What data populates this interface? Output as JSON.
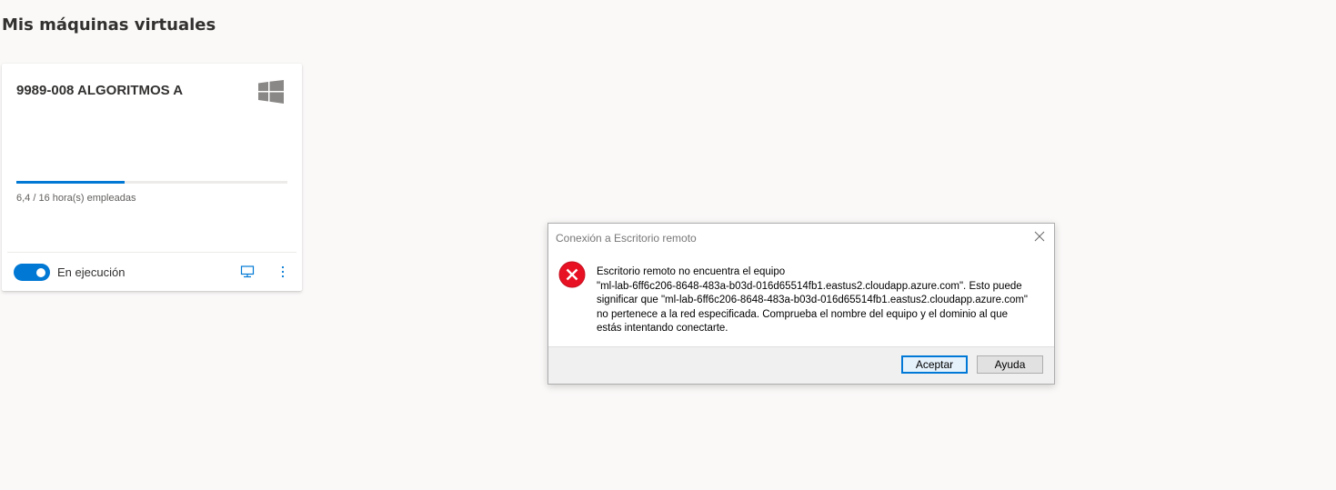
{
  "page": {
    "title": "Mis máquinas virtuales"
  },
  "vm_card": {
    "name": "9989-008 ALGORITMOS A",
    "os_icon": "windows-logo-icon",
    "usage_text": "6,4 / 16 hora(s) empleadas",
    "usage_fraction": 0.4,
    "status_label": "En ejecución",
    "running": true,
    "connect_icon": "monitor-icon",
    "more_icon": "more-vertical-icon",
    "accent_color": "#0078d4"
  },
  "dialog": {
    "title": "Conexión a Escritorio remoto",
    "message": "Escritorio remoto no encuentra el equipo\n\"ml-lab-6ff6c206-8648-483a-b03d-016d65514fb1.eastus2.cloudapp.azure.com\". Esto puede\nsignificar que \"ml-lab-6ff6c206-8648-483a-b03d-016d65514fb1.eastus2.cloudapp.azure.com\"\nno pertenece a la red especificada. Comprueba el nombre del equipo y el dominio al que\nestás intentando conectarte.",
    "ok_label": "Aceptar",
    "help_label": "Ayuda",
    "error_color": "#e81123"
  }
}
